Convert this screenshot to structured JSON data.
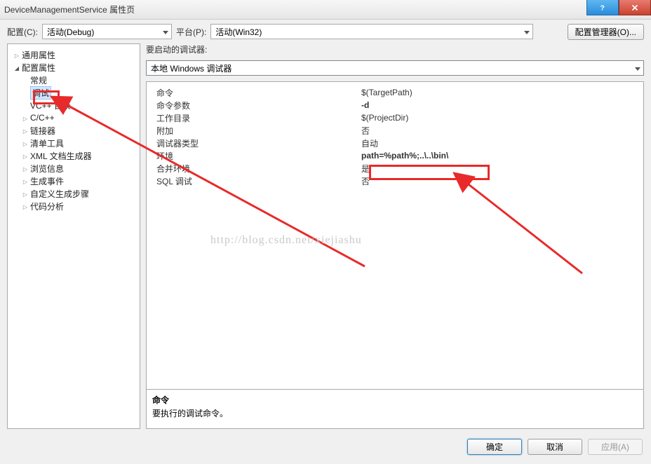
{
  "window": {
    "title": "DeviceManagementService 属性页"
  },
  "toolbar": {
    "config_label": "配置(C):",
    "config_value": "活动(Debug)",
    "platform_label": "平台(P):",
    "platform_value": "活动(Win32)",
    "manager_btn": "配置管理器(O)..."
  },
  "tree": {
    "items": [
      {
        "label": "通用属性",
        "depth": 0,
        "exp": "right"
      },
      {
        "label": "配置属性",
        "depth": 0,
        "exp": "down"
      },
      {
        "label": "常规",
        "depth": 1,
        "exp": "none"
      },
      {
        "label": "调试",
        "depth": 1,
        "exp": "none",
        "selected": true
      },
      {
        "label": "VC++ 目录",
        "depth": 1,
        "exp": "none"
      },
      {
        "label": "C/C++",
        "depth": 1,
        "exp": "right"
      },
      {
        "label": "链接器",
        "depth": 1,
        "exp": "right"
      },
      {
        "label": "清单工具",
        "depth": 1,
        "exp": "right"
      },
      {
        "label": "XML 文档生成器",
        "depth": 1,
        "exp": "right"
      },
      {
        "label": "浏览信息",
        "depth": 1,
        "exp": "right"
      },
      {
        "label": "生成事件",
        "depth": 1,
        "exp": "right"
      },
      {
        "label": "自定义生成步骤",
        "depth": 1,
        "exp": "right"
      },
      {
        "label": "代码分析",
        "depth": 1,
        "exp": "right"
      }
    ]
  },
  "right": {
    "section_label": "要启动的调试器:",
    "debugger_value": "本地 Windows 调试器",
    "grid": [
      {
        "key": "命令",
        "val": "$(TargetPath)"
      },
      {
        "key": "命令参数",
        "val": "-d"
      },
      {
        "key": "工作目录",
        "val": "$(ProjectDir)"
      },
      {
        "key": "附加",
        "val": "否"
      },
      {
        "key": "调试器类型",
        "val": "自动"
      },
      {
        "key": "环境",
        "val": "path=%path%;..\\..\\bin\\"
      },
      {
        "key": "合并环境",
        "val": "是"
      },
      {
        "key": "SQL 调试",
        "val": "否"
      }
    ],
    "desc_title": "命令",
    "desc_text": "要执行的调试命令。"
  },
  "buttons": {
    "ok": "确定",
    "cancel": "取消",
    "apply": "应用(A)"
  },
  "watermark": "http://blog.csdn.net/xiejiashu"
}
